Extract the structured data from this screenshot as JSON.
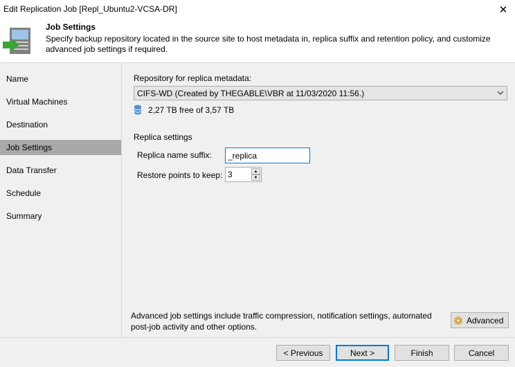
{
  "window": {
    "title": "Edit Replication Job [Repl_Ubuntu2-VCSA-DR]",
    "close_glyph": "✕"
  },
  "header": {
    "title": "Job Settings",
    "description": "Specify backup repository located in the source site to host metadata in, replica suffix and retention policy, and customize advanced job settings if required.",
    "icon": "wizard-page-icon"
  },
  "sidebar": {
    "items": [
      {
        "label": "Name",
        "active": false
      },
      {
        "label": "Virtual Machines",
        "active": false
      },
      {
        "label": "Destination",
        "active": false
      },
      {
        "label": "Job Settings",
        "active": true
      },
      {
        "label": "Data Transfer",
        "active": false
      },
      {
        "label": "Schedule",
        "active": false
      },
      {
        "label": "Summary",
        "active": false
      }
    ]
  },
  "main": {
    "repository_label": "Repository for replica metadata:",
    "repository_value": "CIFS-WD (Created by THEGABLE\\VBR at 11/03/2020 11:56.)",
    "free_space": "2,27 TB free of 3,57 TB",
    "replica_settings_label": "Replica settings",
    "suffix_label": "Replica name suffix:",
    "suffix_value": "_replica",
    "restore_points_label": "Restore points to keep:",
    "restore_points_value": "3",
    "advanced_text": "Advanced job settings include traffic compression, notification settings, automated post-job activity and other options.",
    "advanced_button": "Advanced"
  },
  "footer": {
    "previous": "< Previous",
    "next": "Next >",
    "finish": "Finish",
    "cancel": "Cancel"
  },
  "colors": {
    "sidebar_bg": "#f0f0f0",
    "active_step": "#a9a9a9",
    "focus_border": "#0078d7",
    "icon_green": "#3aa639",
    "db_icon": "#5b8fd6"
  }
}
